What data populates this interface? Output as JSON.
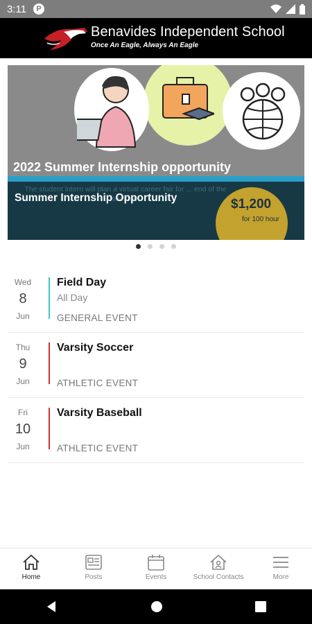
{
  "status_bar": {
    "time": "3:11",
    "notification_icon": "P"
  },
  "header": {
    "school_name": "Benavides Independent School",
    "motto": "Once An Eagle, Always An Eagle"
  },
  "banner": {
    "headline": "2022 Summer Internship opportunity",
    "overlay_title": "Summer Internship Opportunity",
    "faded_text": "The student intern will plan a virtual career fair for ... end of the summer.",
    "amount": "$1,200",
    "amount_sub": "for 100 hour"
  },
  "carousel": {
    "pages": 4,
    "active": 0
  },
  "events": [
    {
      "dow": "Wed",
      "day": "8",
      "month": "Jun",
      "name": "Field Day",
      "time": "All Day",
      "category": "GENERAL EVENT",
      "color": "#39c6c6"
    },
    {
      "dow": "Thu",
      "day": "9",
      "month": "Jun",
      "name": "Varsity Soccer",
      "time": "",
      "category": "ATHLETIC EVENT",
      "color": "#d0302c"
    },
    {
      "dow": "Fri",
      "day": "10",
      "month": "Jun",
      "name": "Varsity Baseball",
      "time": "",
      "category": "ATHLETIC EVENT",
      "color": "#d0302c"
    }
  ],
  "tabs": [
    {
      "label": "Home",
      "icon": "home-icon"
    },
    {
      "label": "Posts",
      "icon": "posts-icon"
    },
    {
      "label": "Events",
      "icon": "calendar-icon"
    },
    {
      "label": "School Contacts",
      "icon": "contacts-icon"
    },
    {
      "label": "More",
      "icon": "menu-icon"
    }
  ]
}
